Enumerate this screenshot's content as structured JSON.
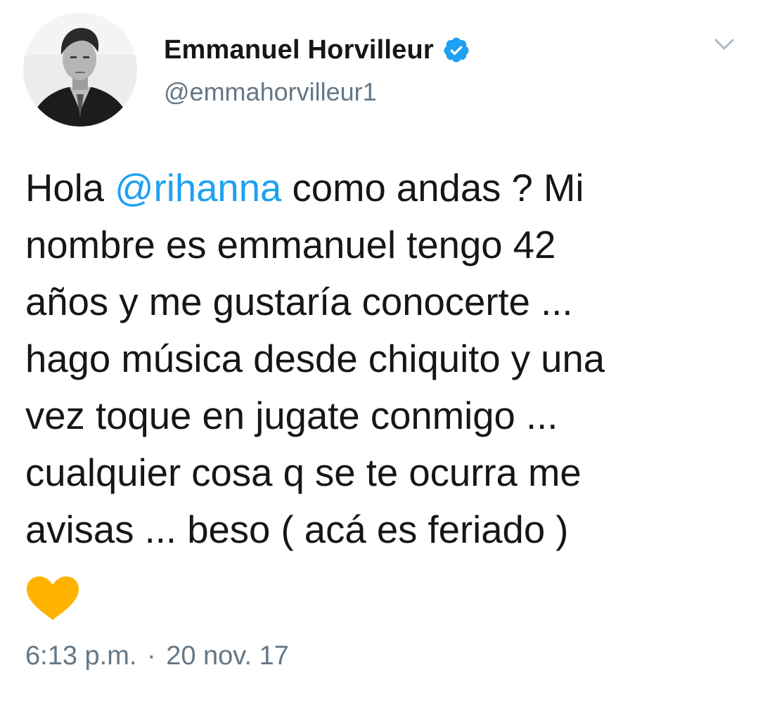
{
  "author": {
    "display_name": "Emmanuel Horvilleur",
    "handle": "@emmahorvilleur1",
    "verified": true,
    "avatar_icon": "user-avatar"
  },
  "menu": {
    "icon": "chevron-down-icon"
  },
  "tweet": {
    "lines": [
      {
        "before": "Hola ",
        "mention": "@rihanna",
        "after": " como andas ? Mi"
      },
      {
        "text": "nombre es emmanuel tengo 42"
      },
      {
        "text": "años y me gustaría conocerte ..."
      },
      {
        "text": "hago música desde chiquito y una"
      },
      {
        "text": "vez toque en jugate conmigo ..."
      },
      {
        "text": "cualquier cosa q se te ocurra me"
      },
      {
        "text": "avisas ... beso ( acá es feriado )"
      }
    ],
    "emoji": "yellow-heart-icon"
  },
  "meta": {
    "time": "6:13 p.m.",
    "separator": "·",
    "date": "20 nov. 17"
  },
  "colors": {
    "text": "#14171a",
    "secondary": "#657786",
    "mention": "#1da1f2",
    "verified": "#1da1f2",
    "heart": "#ffb300"
  }
}
